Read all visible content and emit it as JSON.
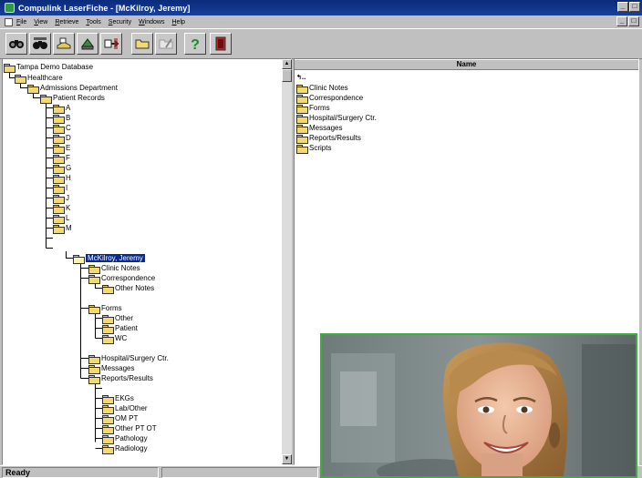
{
  "window": {
    "title": "Compulink LaserFiche - [McKilroy, Jeremy]",
    "controls": [
      "_",
      "□"
    ]
  },
  "menu": {
    "items": [
      {
        "label": "File",
        "accel": "F",
        "rest": "ile"
      },
      {
        "label": "View",
        "accel": "V",
        "rest": "iew"
      },
      {
        "label": "Retrieve",
        "accel": "R",
        "rest": "etrieve"
      },
      {
        "label": "Tools",
        "accel": "T",
        "rest": "ools"
      },
      {
        "label": "Security",
        "accel": "S",
        "rest": "ecurity"
      },
      {
        "label": "Windows",
        "accel": "W",
        "rest": "indows"
      },
      {
        "label": "Help",
        "accel": "H",
        "rest": "elp"
      }
    ]
  },
  "toolbar": {
    "buttons": [
      "search-icon",
      "search-all-icon",
      "scanner-icon",
      "printer-icon",
      "export-icon",
      "open-folder-icon",
      "edit-folder-icon",
      "help-icon",
      "exit-icon"
    ]
  },
  "tree": {
    "root": "Tampa Demo Database",
    "healthcare": "Healthcare",
    "admissions": "Admissions Department",
    "patient_records": "Patient Records",
    "letters": [
      "A",
      "B",
      "C",
      "D",
      "E",
      "F",
      "G",
      "H",
      "I",
      "J",
      "K",
      "L",
      "M"
    ],
    "selected": "McKilroy, Jeremy",
    "clinic_notes": "Clinic Notes",
    "correspondence": "Correspondence",
    "other_notes": "Other Notes",
    "forms": "Forms",
    "forms_children": [
      "Other",
      "Patient",
      "WC"
    ],
    "hospital": "Hospital/Surgery Ctr.",
    "messages": "Messages",
    "reports": "Reports/Results",
    "reports_children": [
      "EKGs",
      "Lab/Other",
      "OM PT",
      "Other PT OT",
      "Pathology",
      "Radiology"
    ]
  },
  "list": {
    "header": "Name",
    "up_item": "..",
    "items": [
      "Clinic Notes",
      "Correspondence",
      "Forms",
      "Hospital/Surgery Ctr.",
      "Messages",
      "Reports/Results",
      "Scripts"
    ]
  },
  "status": {
    "text": "Ready"
  },
  "colors": {
    "title_bar": "#0a2a7a",
    "selection": "#0a2a8a",
    "folder": "#f4d870",
    "photo_border": "#3fae3f"
  }
}
